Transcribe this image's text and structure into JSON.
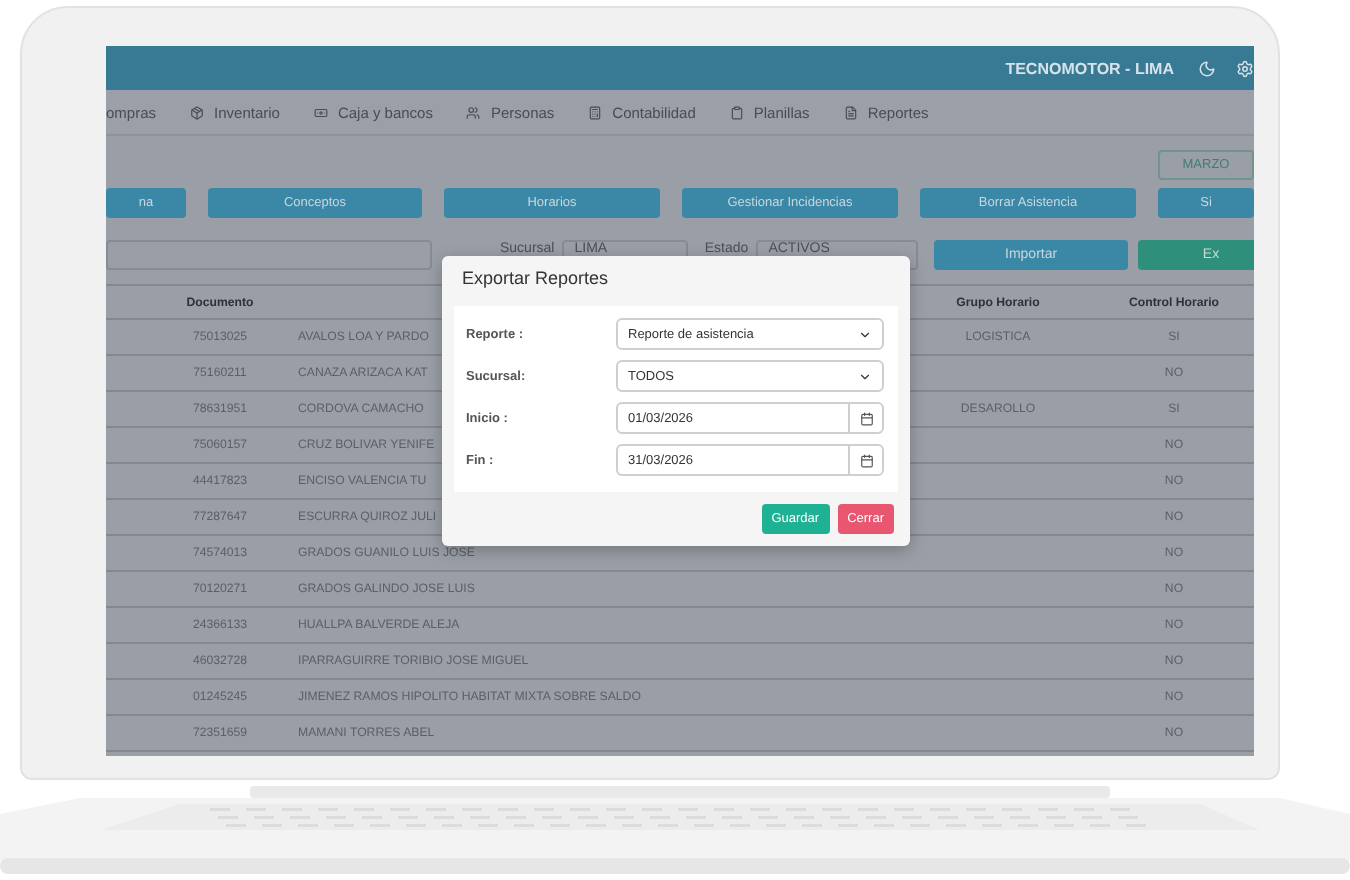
{
  "header": {
    "title": "TECNOMOTOR - LIMA"
  },
  "nav": [
    {
      "label": "ompras"
    },
    {
      "label": "Inventario"
    },
    {
      "label": "Caja y bancos"
    },
    {
      "label": "Personas"
    },
    {
      "label": "Contabilidad"
    },
    {
      "label": "Planillas"
    },
    {
      "label": "Reportes"
    }
  ],
  "period_button": "MARZO",
  "action_buttons": [
    "na",
    "Conceptos",
    "Horarios",
    "Gestionar Incidencias",
    "Borrar Asistencia",
    "Si"
  ],
  "filters": {
    "sucursal_label": "Sucursal",
    "sucursal_value": "LIMA",
    "estado_label": "Estado",
    "estado_value": "ACTIVOS",
    "import_button": "Importar",
    "export_button": "Ex"
  },
  "table": {
    "columns": [
      {
        "label": "Documento"
      },
      {
        "label": "Grupo Horario"
      },
      {
        "label": "Control Horario"
      }
    ],
    "rows": [
      {
        "documento": "75013025",
        "name": "AVALOS LOA Y PARDO",
        "grupo": "LOGISTICA",
        "control": "SI"
      },
      {
        "documento": "75160211",
        "name": "CANAZA ARIZACA KAT",
        "control": "NO"
      },
      {
        "documento": "78631951",
        "name": "CORDOVA CAMACHO",
        "grupo": "DESAROLLO",
        "control": "SI"
      },
      {
        "documento": "75060157",
        "name": "CRUZ BOLIVAR YENIFE",
        "control": "NO"
      },
      {
        "documento": "44417823",
        "name": "ENCISO VALENCIA TU",
        "control": "NO"
      },
      {
        "documento": "77287647",
        "name": "ESCURRA QUIROZ JULI",
        "control": "NO"
      },
      {
        "documento": "74574013",
        "name": "GRADOS GUANILO LUIS JOSE",
        "control": "NO"
      },
      {
        "documento": "70120271",
        "name": "GRADOS GALINDO JOSE LUIS",
        "control": "NO"
      },
      {
        "documento": "24366133",
        "name": "HUALLPA BALVERDE ALEJA",
        "control": "NO"
      },
      {
        "documento": "46032728",
        "name": "IPARRAGUIRRE TORIBIO JOSE MIGUEL",
        "control": "NO"
      },
      {
        "documento": "01245245",
        "name": "JIMENEZ RAMOS HIPOLITO HABITAT MIXTA SOBRE SALDO",
        "control": "NO"
      },
      {
        "documento": "72351659",
        "name": "MAMANI TORRES ABEL",
        "control": "NO"
      }
    ]
  },
  "modal": {
    "title": "Exportar Reportes",
    "fields": [
      {
        "kind": "select",
        "label": "Reporte :",
        "value": "Reporte de asistencia"
      },
      {
        "kind": "select",
        "label": "Sucursal:",
        "value": "TODOS"
      },
      {
        "kind": "date",
        "label": "Inicio :",
        "value": "01/03/2026"
      },
      {
        "kind": "date",
        "label": "Fin :",
        "value": "31/03/2026"
      }
    ],
    "buttons": [
      {
        "kind": "primary",
        "label": "Guardar"
      },
      {
        "kind": "danger",
        "label": "Cerrar"
      }
    ]
  }
}
